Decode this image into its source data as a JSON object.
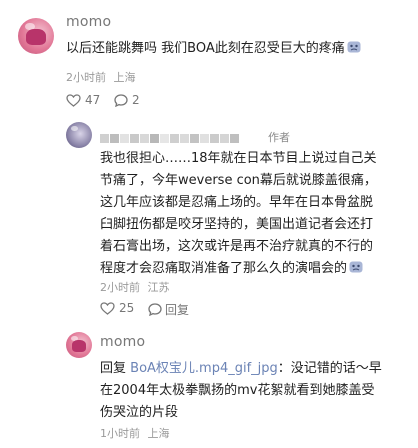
{
  "comments": [
    {
      "username": "momo",
      "text": "以后还能跳舞吗 我们BOA此刻在忍受巨大的疼痛",
      "time": "2小时前",
      "location": "上海",
      "likes": "47",
      "replies": "2"
    },
    {
      "username": "",
      "author_tag": "作者",
      "lines": [
        "我也很担心……18年就在日本节目上说过自己关",
        "节痛了，今年weverse con幕后就说膝盖很痛，",
        "这几年应该都是忍痛上场的。早年在日本骨盆脱",
        "臼脚扭伤都是咬牙坚持的，美国出道记者会还打",
        "着石膏出场，这次或许是再不治疗就真的不行的",
        "程度才会忍痛取消准备了那么久的演唱会的"
      ],
      "time": "2小时前",
      "location": "江苏",
      "likes": "25",
      "reply_label": "回复"
    },
    {
      "username": "momo",
      "reply_prefix": "回复",
      "reply_to": "BoA权宝儿.mp4_gif_jpg",
      "line1_rest": "：没记错的话～早",
      "line2": "在2004年太极拳飘扬的mv花絮就看到她膝盖受",
      "line3": "伤哭泣的片段",
      "time": "1小时前",
      "location": "上海"
    }
  ],
  "icons": {
    "like": "heart-outline-icon",
    "comment": "speech-bubble-icon",
    "emoji": "crying-face-emoji-icon",
    "avatar": "user-avatar"
  },
  "colors": {
    "link": "#6b83b5",
    "meta": "#9a9a9a",
    "name": "#777777",
    "text": "#1f1f1f"
  }
}
